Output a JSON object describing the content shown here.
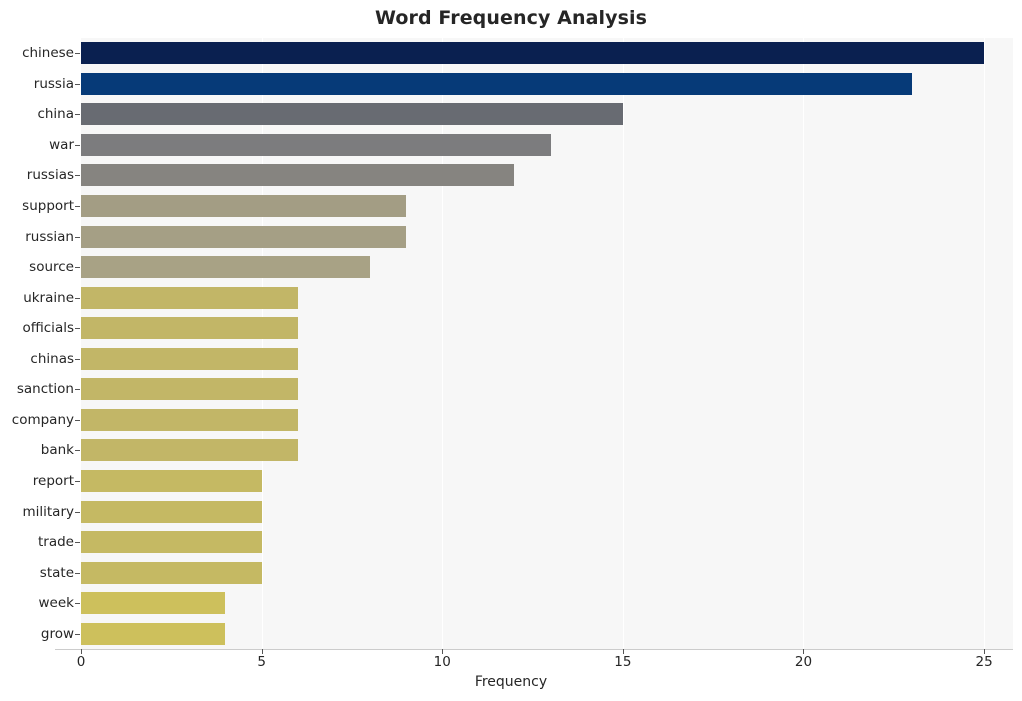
{
  "chart_data": {
    "type": "bar",
    "orientation": "horizontal",
    "title": "Word Frequency Analysis",
    "xlabel": "Frequency",
    "ylabel": "",
    "xlim": [
      0,
      25.8
    ],
    "xticks": [
      0,
      5,
      10,
      15,
      20,
      25
    ],
    "grid": "vertical",
    "legend": "none",
    "categories": [
      "chinese",
      "russia",
      "china",
      "war",
      "russias",
      "support",
      "russian",
      "source",
      "ukraine",
      "officials",
      "chinas",
      "sanction",
      "company",
      "bank",
      "report",
      "military",
      "trade",
      "state",
      "week",
      "grow"
    ],
    "values": [
      25,
      23,
      15,
      13,
      12,
      9,
      9,
      8,
      6,
      6,
      6,
      6,
      6,
      6,
      5,
      5,
      5,
      5,
      4,
      4
    ],
    "bar_colors": [
      "#0a2050",
      "#063a78",
      "#686b72",
      "#7c7c7e",
      "#868480",
      "#a39d84",
      "#a59f85",
      "#a8a285",
      "#c2b667",
      "#c2b667",
      "#c2b667",
      "#c2b667",
      "#c2b667",
      "#c2b667",
      "#c5b963",
      "#c5b963",
      "#c5b963",
      "#c5b963",
      "#cdc05c",
      "#cdc05c"
    ],
    "plot_background": "#f7f7f7",
    "gridline_color": "#ffffff"
  }
}
